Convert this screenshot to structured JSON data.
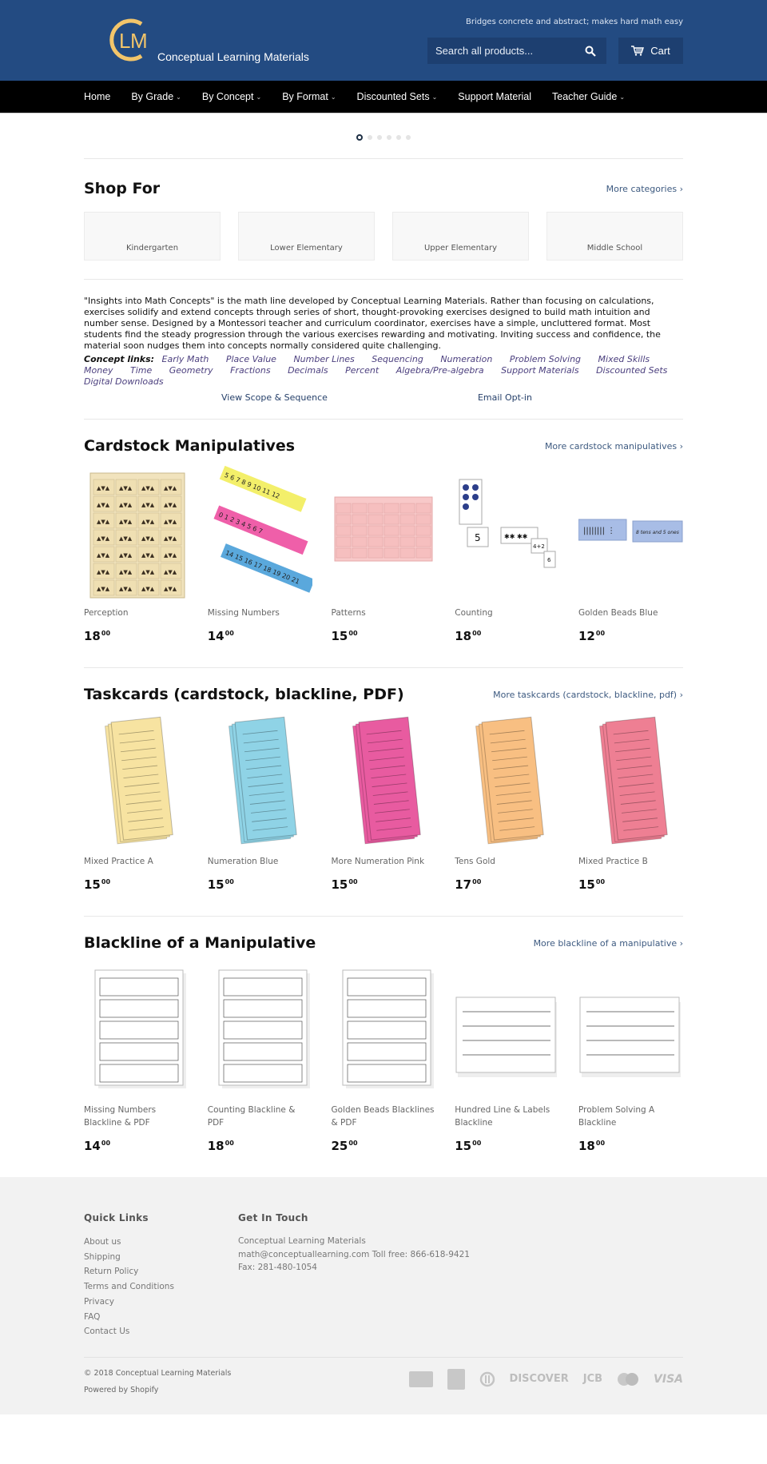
{
  "header": {
    "logo_initials": "CLM",
    "logo_text": "Conceptual Learning Materials",
    "tagline": "Bridges concrete and abstract; makes hard math easy",
    "search_placeholder": "Search all products...",
    "cart_label": "Cart",
    "colors": {
      "header_bg": "#234b82",
      "logo_gold": "#f3c56a",
      "nav_bg": "#000000"
    }
  },
  "nav": {
    "items": [
      {
        "label": "Home",
        "dropdown": false
      },
      {
        "label": "By Grade",
        "dropdown": true
      },
      {
        "label": "By Concept",
        "dropdown": true
      },
      {
        "label": "By Format",
        "dropdown": true
      },
      {
        "label": "Discounted Sets",
        "dropdown": true
      },
      {
        "label": "Support Material",
        "dropdown": false
      },
      {
        "label": "Teacher Guide",
        "dropdown": true
      }
    ],
    "chevron": "⌄"
  },
  "slider": {
    "dot_count": 6,
    "active_index": 0
  },
  "shop_for": {
    "title": "Shop For",
    "more_link": "More categories ›",
    "categories": [
      "Kindergarten",
      "Lower Elementary",
      "Upper Elementary",
      "Middle School"
    ]
  },
  "intro": {
    "paragraph": "\"Insights into Math Concepts\" is the math line developed by Conceptual Learning Materials. Rather than focusing on calculations, exercises solidify and extend concepts through series of short, thought-provoking exercises designed to build math intuition and number sense. Designed by a Montessori teacher and curriculum coordinator, exercises have a simple, uncluttered format. Most students find the steady progression through the various exercises rewarding and motivating. Inviting success and confidence, the material soon nudges them into concepts normally considered quite challenging.",
    "concept_label": "Concept links:",
    "concept_links": [
      "Early Math",
      "Place Value",
      "Number Lines",
      "Sequencing",
      "Numeration",
      "Problem Solving",
      "Mixed Skills",
      "Money",
      "Time",
      "Geometry",
      "Fractions",
      "Decimals",
      "Percent",
      "Algebra/Pre-algebra",
      "Support Materials",
      "Discounted Sets",
      "Digital Downloads"
    ],
    "scope_link": "View Scope & Sequence",
    "email_link": "Email Opt-in"
  },
  "sections": [
    {
      "title": "Cardstock Manipulatives",
      "more_link": "More cardstock manipulatives ›",
      "products": [
        {
          "name": "Perception",
          "price_main": "18",
          "price_cents": "00",
          "image": "perception-cards"
        },
        {
          "name": "Missing Numbers",
          "price_main": "14",
          "price_cents": "00",
          "image": "missing-numbers-strips"
        },
        {
          "name": "Patterns",
          "price_main": "15",
          "price_cents": "00",
          "image": "patterns-cards"
        },
        {
          "name": "Counting",
          "price_main": "18",
          "price_cents": "00",
          "image": "counting-cards"
        },
        {
          "name": "Golden Beads Blue",
          "price_main": "12",
          "price_cents": "00",
          "image": "golden-beads-blue-cards"
        }
      ]
    },
    {
      "title": "Taskcards (cardstock, blackline, PDF)",
      "more_link": "More taskcards (cardstock, blackline, pdf) ›",
      "products": [
        {
          "name": "Mixed Practice A",
          "price_main": "15",
          "price_cents": "00",
          "image": "taskcard-yellow",
          "color": "#f7e3a1"
        },
        {
          "name": "Numeration Blue",
          "price_main": "15",
          "price_cents": "00",
          "image": "taskcard-blue",
          "color": "#8fd3e6"
        },
        {
          "name": "More Numeration Pink",
          "price_main": "15",
          "price_cents": "00",
          "image": "taskcard-magenta",
          "color": "#e85ba0"
        },
        {
          "name": "Tens Gold",
          "price_main": "17",
          "price_cents": "00",
          "image": "taskcard-orange",
          "color": "#f8bf82"
        },
        {
          "name": "Mixed Practice B",
          "price_main": "15",
          "price_cents": "00",
          "image": "taskcard-pink",
          "color": "#ee7f93"
        }
      ]
    },
    {
      "title": "Blackline of a Manipulative",
      "more_link": "More blackline of a manipulative ›",
      "products": [
        {
          "name": "Missing Numbers Blackline & PDF",
          "price_main": "14",
          "price_cents": "00",
          "image": "blackline-sheet"
        },
        {
          "name": "Counting Blackline & PDF",
          "price_main": "18",
          "price_cents": "00",
          "image": "blackline-sheet"
        },
        {
          "name": "Golden Beads Blacklines & PDF",
          "price_main": "25",
          "price_cents": "00",
          "image": "blackline-sheet"
        },
        {
          "name": "Hundred Line & Labels Blackline",
          "price_main": "15",
          "price_cents": "00",
          "image": "blackline-landscape"
        },
        {
          "name": "Problem Solving A Blackline",
          "price_main": "18",
          "price_cents": "00",
          "image": "blackline-landscape"
        }
      ]
    }
  ],
  "footer": {
    "quick_links_title": "Quick Links",
    "quick_links": [
      "About us",
      "Shipping",
      "Return Policy",
      "Terms and Conditions",
      "Privacy",
      "FAQ",
      "Contact Us"
    ],
    "contact_title": "Get In Touch",
    "contact_lines": [
      "Conceptual Learning Materials",
      "math@conceptuallearning.com Toll free: 866-618-9421",
      "Fax: 281-480-1054"
    ],
    "copyright": "© 2018 Conceptual Learning Materials",
    "powered_by": "Powered by Shopify",
    "payment_icons": [
      "amazon-payments-icon",
      "american-express-icon",
      "diners-club-icon",
      "discover-icon",
      "jcb-icon",
      "master-icon",
      "visa-icon"
    ],
    "payment_labels": {
      "discover": "DISCOVER",
      "jcb": "JCB",
      "visa": "VISA"
    }
  }
}
